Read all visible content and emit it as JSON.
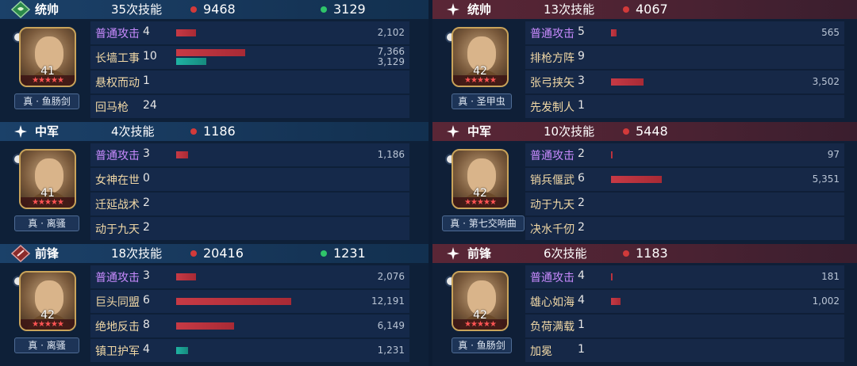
{
  "left": [
    {
      "role": "统帅",
      "skills": "35次技能",
      "damage": "9468",
      "heal": "3129",
      "portrait": {
        "level": "41",
        "stars": "★★★★★"
      },
      "weapon": "真 · 鱼肠剑",
      "rows": [
        {
          "name": "普通攻击",
          "count": "4",
          "numbers": [
            "2,102"
          ],
          "bars": [
            {
              "type": "red",
              "fraction": 0.087
            }
          ]
        },
        {
          "name": "长墙工事",
          "count": "10",
          "numbers": [
            "7,366",
            "3,129"
          ],
          "bars": [
            {
              "type": "red",
              "fraction": 0.3
            },
            {
              "type": "teal",
              "fraction": 0.13
            }
          ]
        },
        {
          "name": "悬权而动",
          "count": "1",
          "numbers": [],
          "bars": []
        },
        {
          "name": "回马枪",
          "count": "24",
          "numbers": [],
          "bars": []
        }
      ]
    },
    {
      "role": "中军",
      "skills": "4次技能",
      "damage": "1186",
      "heal": "",
      "portrait": {
        "level": "41",
        "stars": "★★★★★"
      },
      "weapon": "真 · 离骚",
      "rows": [
        {
          "name": "普通攻击",
          "count": "3",
          "numbers": [
            "1,186"
          ],
          "bars": [
            {
              "type": "red",
              "fraction": 0.05
            }
          ]
        },
        {
          "name": "女神在世",
          "count": "0",
          "numbers": [],
          "bars": []
        },
        {
          "name": "迁延战术",
          "count": "2",
          "numbers": [],
          "bars": []
        },
        {
          "name": "动于九天",
          "count": "2",
          "numbers": [],
          "bars": []
        }
      ]
    },
    {
      "role": "前锋",
      "skills": "18次技能",
      "damage": "20416",
      "heal": "1231",
      "portrait": {
        "level": "42",
        "stars": "★★★★★"
      },
      "weapon": "真 · 离骚",
      "rows": [
        {
          "name": "普通攻击",
          "count": "3",
          "numbers": [
            "2,076"
          ],
          "bars": [
            {
              "type": "red",
              "fraction": 0.085
            }
          ]
        },
        {
          "name": "巨头同盟",
          "count": "6",
          "numbers": [
            "12,191"
          ],
          "bars": [
            {
              "type": "red",
              "fraction": 0.5
            }
          ]
        },
        {
          "name": "绝地反击",
          "count": "8",
          "numbers": [
            "6,149"
          ],
          "bars": [
            {
              "type": "red",
              "fraction": 0.25
            }
          ]
        },
        {
          "name": "镇卫护军",
          "count": "4",
          "numbers": [
            "1,231"
          ],
          "bars": [
            {
              "type": "teal",
              "fraction": 0.05
            }
          ]
        }
      ]
    }
  ],
  "right": [
    {
      "role": "统帅",
      "skills": "13次技能",
      "damage": "4067",
      "heal": "",
      "portrait": {
        "level": "42",
        "stars": "★★★★★"
      },
      "weapon": "真 · 圣甲虫",
      "rows": [
        {
          "name": "普通攻击",
          "count": "5",
          "numbers": [
            "565"
          ],
          "bars": [
            {
              "type": "red",
              "fraction": 0.023
            }
          ]
        },
        {
          "name": "排枪方阵",
          "count": "9",
          "numbers": [],
          "bars": []
        },
        {
          "name": "张弓挟矢",
          "count": "3",
          "numbers": [
            "3,502"
          ],
          "bars": [
            {
              "type": "red",
              "fraction": 0.143
            }
          ]
        },
        {
          "name": "先发制人",
          "count": "1",
          "numbers": [],
          "bars": []
        }
      ]
    },
    {
      "role": "中军",
      "skills": "10次技能",
      "damage": "5448",
      "heal": "",
      "portrait": {
        "level": "42",
        "stars": "★★★★★"
      },
      "weapon": "真 · 第七交响曲",
      "rows": [
        {
          "name": "普通攻击",
          "count": "2",
          "numbers": [
            "97"
          ],
          "bars": [
            {
              "type": "red",
              "fraction": 0.004
            }
          ]
        },
        {
          "name": "销兵偃武",
          "count": "6",
          "numbers": [
            "5,351"
          ],
          "bars": [
            {
              "type": "red",
              "fraction": 0.22
            }
          ]
        },
        {
          "name": "动于九天",
          "count": "2",
          "numbers": [],
          "bars": []
        },
        {
          "name": "决水千仞",
          "count": "2",
          "numbers": [],
          "bars": []
        }
      ]
    },
    {
      "role": "前锋",
      "skills": "6次技能",
      "damage": "1183",
      "heal": "",
      "portrait": {
        "level": "42",
        "stars": "★★★★★"
      },
      "weapon": "真 · 鱼肠剑",
      "rows": [
        {
          "name": "普通攻击",
          "count": "4",
          "numbers": [
            "181"
          ],
          "bars": [
            {
              "type": "red",
              "fraction": 0.008
            }
          ]
        },
        {
          "name": "雄心如海",
          "count": "4",
          "numbers": [
            "1,002"
          ],
          "bars": [
            {
              "type": "red",
              "fraction": 0.04
            }
          ]
        },
        {
          "name": "负荷满载",
          "count": "1",
          "numbers": [],
          "bars": []
        },
        {
          "name": "加冕",
          "count": "1",
          "numbers": [],
          "bars": []
        }
      ]
    }
  ],
  "colors": {
    "damage_dot": "#d23a3a",
    "heal_dot": "#2fc46a",
    "normal_attack": "#c98bff",
    "skill_name": "#f1d8a6"
  },
  "icons": {
    "left_badges": [
      "green-diamond-icon",
      "white-sparkle-icon",
      "red-diamond-icon"
    ],
    "right_badges": [
      "white-sparkle-icon",
      "white-sparkle-icon",
      "white-sparkle-icon"
    ]
  }
}
